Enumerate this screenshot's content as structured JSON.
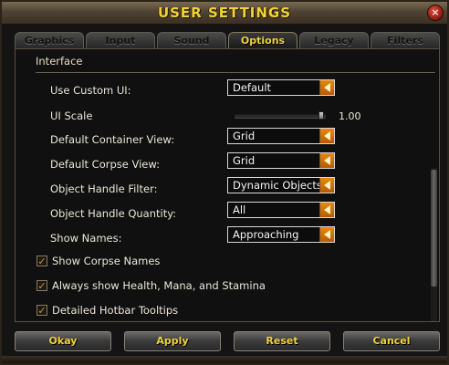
{
  "window": {
    "title": "USER SETTINGS",
    "close_glyph": "×"
  },
  "tabs": [
    {
      "label": "Graphics"
    },
    {
      "label": "Input"
    },
    {
      "label": "Sound"
    },
    {
      "label": "Options",
      "active": true
    },
    {
      "label": "Legacy"
    },
    {
      "label": "Filters"
    }
  ],
  "section": {
    "title": "Interface"
  },
  "settings": {
    "use_custom_ui": {
      "label": "Use Custom UI:",
      "value": "Default"
    },
    "ui_scale": {
      "label": "UI Scale",
      "value": "1.00",
      "level": 0.95
    },
    "default_container_view": {
      "label": "Default Container View:",
      "value": "Grid"
    },
    "default_corpse_view": {
      "label": "Default Corpse View:",
      "value": "Grid"
    },
    "object_handle_filter": {
      "label": "Object Handle Filter:",
      "value": "Dynamic Objects"
    },
    "object_handle_quantity": {
      "label": "Object Handle Quantity:",
      "value": "All"
    },
    "show_names": {
      "label": "Show Names:",
      "value": "Approaching"
    }
  },
  "checkboxes": [
    {
      "label": "Show Corpse Names",
      "checked": true
    },
    {
      "label": "Always show Health, Mana, and Stamina",
      "checked": true
    },
    {
      "label": "Detailed Hotbar Tooltips",
      "checked": true
    }
  ],
  "buttons": {
    "okay": "Okay",
    "apply": "Apply",
    "reset": "Reset",
    "cancel": "Cancel"
  },
  "colors": {
    "title_gold": "#f2d23a",
    "dropdown_arrow": "#e38a10",
    "check_mark": "#f08a10"
  }
}
